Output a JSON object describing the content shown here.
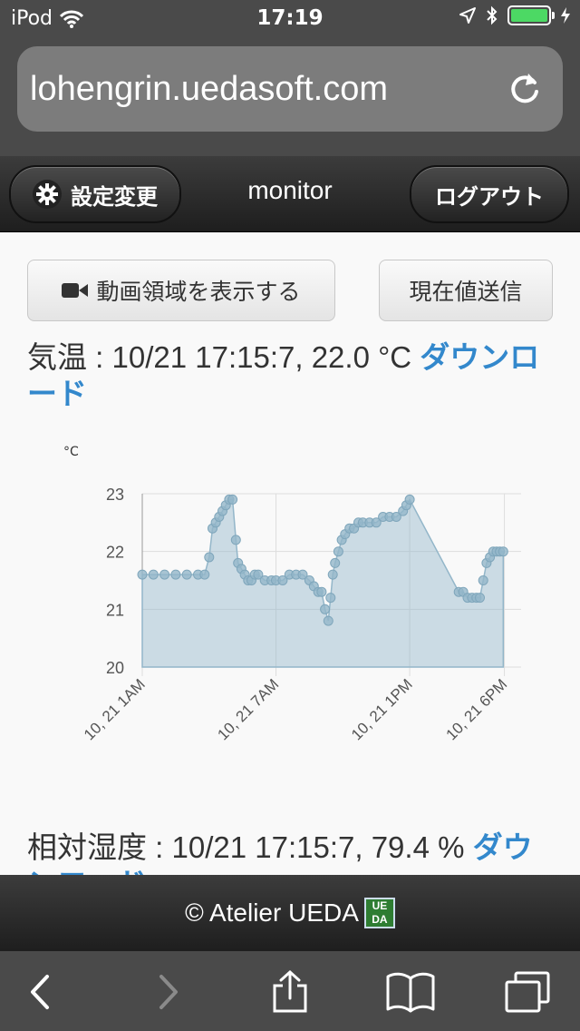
{
  "status_bar": {
    "carrier": "iPod",
    "time": "17:19",
    "battery_level": 1.0
  },
  "browser": {
    "url": "lohengrin.uedasoft.com"
  },
  "header": {
    "settings_label": "設定変更",
    "title": "monitor",
    "logout_label": "ログアウト"
  },
  "actions": {
    "show_video_label": "動画領域を表示する",
    "send_current_label": "現在値送信"
  },
  "temperature": {
    "label": "気温 : 10/21 17:15:7, 22.0 °C",
    "download_label": "ダウンロード"
  },
  "humidity": {
    "label": "相対湿度 : 10/21 17:15:7, 79.4 %",
    "download_label": "ダウンロード"
  },
  "chart_data": {
    "type": "area",
    "ylabel": "°C",
    "ylim": [
      20,
      23
    ],
    "yticks": [
      "20",
      "21",
      "22",
      "23"
    ],
    "xlim": [
      0,
      17
    ],
    "xticks": [
      {
        "x": 0,
        "label": "10, 21 1AM"
      },
      {
        "x": 6,
        "label": "10, 21 7AM"
      },
      {
        "x": 12,
        "label": "10, 21 1PM"
      },
      {
        "x": 16.25,
        "label": "10, 21 6PM"
      }
    ],
    "series": [
      {
        "color": "#93b6c9",
        "x": [
          0,
          0.5,
          1,
          1.5,
          2,
          2.5,
          2.8,
          3.0,
          3.15,
          3.3,
          3.45,
          3.6,
          3.75,
          3.9,
          4.05,
          4.2,
          4.3,
          4.45,
          4.6,
          4.75,
          4.9,
          5.05,
          5.2,
          5.5,
          5.8,
          6.0,
          6.3,
          6.6,
          6.9,
          7.2,
          7.5,
          7.7,
          7.9,
          8.05,
          8.2,
          8.35,
          8.45,
          8.55,
          8.65,
          8.8,
          8.95,
          9.1,
          9.3,
          9.5,
          9.7,
          9.9,
          10.2,
          10.5,
          10.8,
          11.1,
          11.4,
          11.7,
          11.85,
          12.0,
          14.2,
          14.4,
          14.6,
          14.8,
          15.0,
          15.15,
          15.3,
          15.45,
          15.6,
          15.75,
          15.9,
          16.05,
          16.2
        ],
        "values": [
          21.6,
          21.6,
          21.6,
          21.6,
          21.6,
          21.6,
          21.6,
          21.9,
          22.4,
          22.5,
          22.6,
          22.7,
          22.8,
          22.9,
          22.9,
          22.2,
          21.8,
          21.7,
          21.6,
          21.5,
          21.5,
          21.6,
          21.6,
          21.5,
          21.5,
          21.5,
          21.5,
          21.6,
          21.6,
          21.6,
          21.5,
          21.4,
          21.3,
          21.3,
          21.0,
          20.8,
          21.2,
          21.6,
          21.8,
          22.0,
          22.2,
          22.3,
          22.4,
          22.4,
          22.5,
          22.5,
          22.5,
          22.5,
          22.6,
          22.6,
          22.6,
          22.7,
          22.8,
          22.9,
          21.3,
          21.3,
          21.2,
          21.2,
          21.2,
          21.2,
          21.5,
          21.8,
          21.9,
          22.0,
          22.0,
          22.0,
          22.0
        ]
      }
    ]
  },
  "footer": {
    "copyright": "© Atelier UEDA",
    "logo_top": "UE",
    "logo_bottom": "DA"
  }
}
